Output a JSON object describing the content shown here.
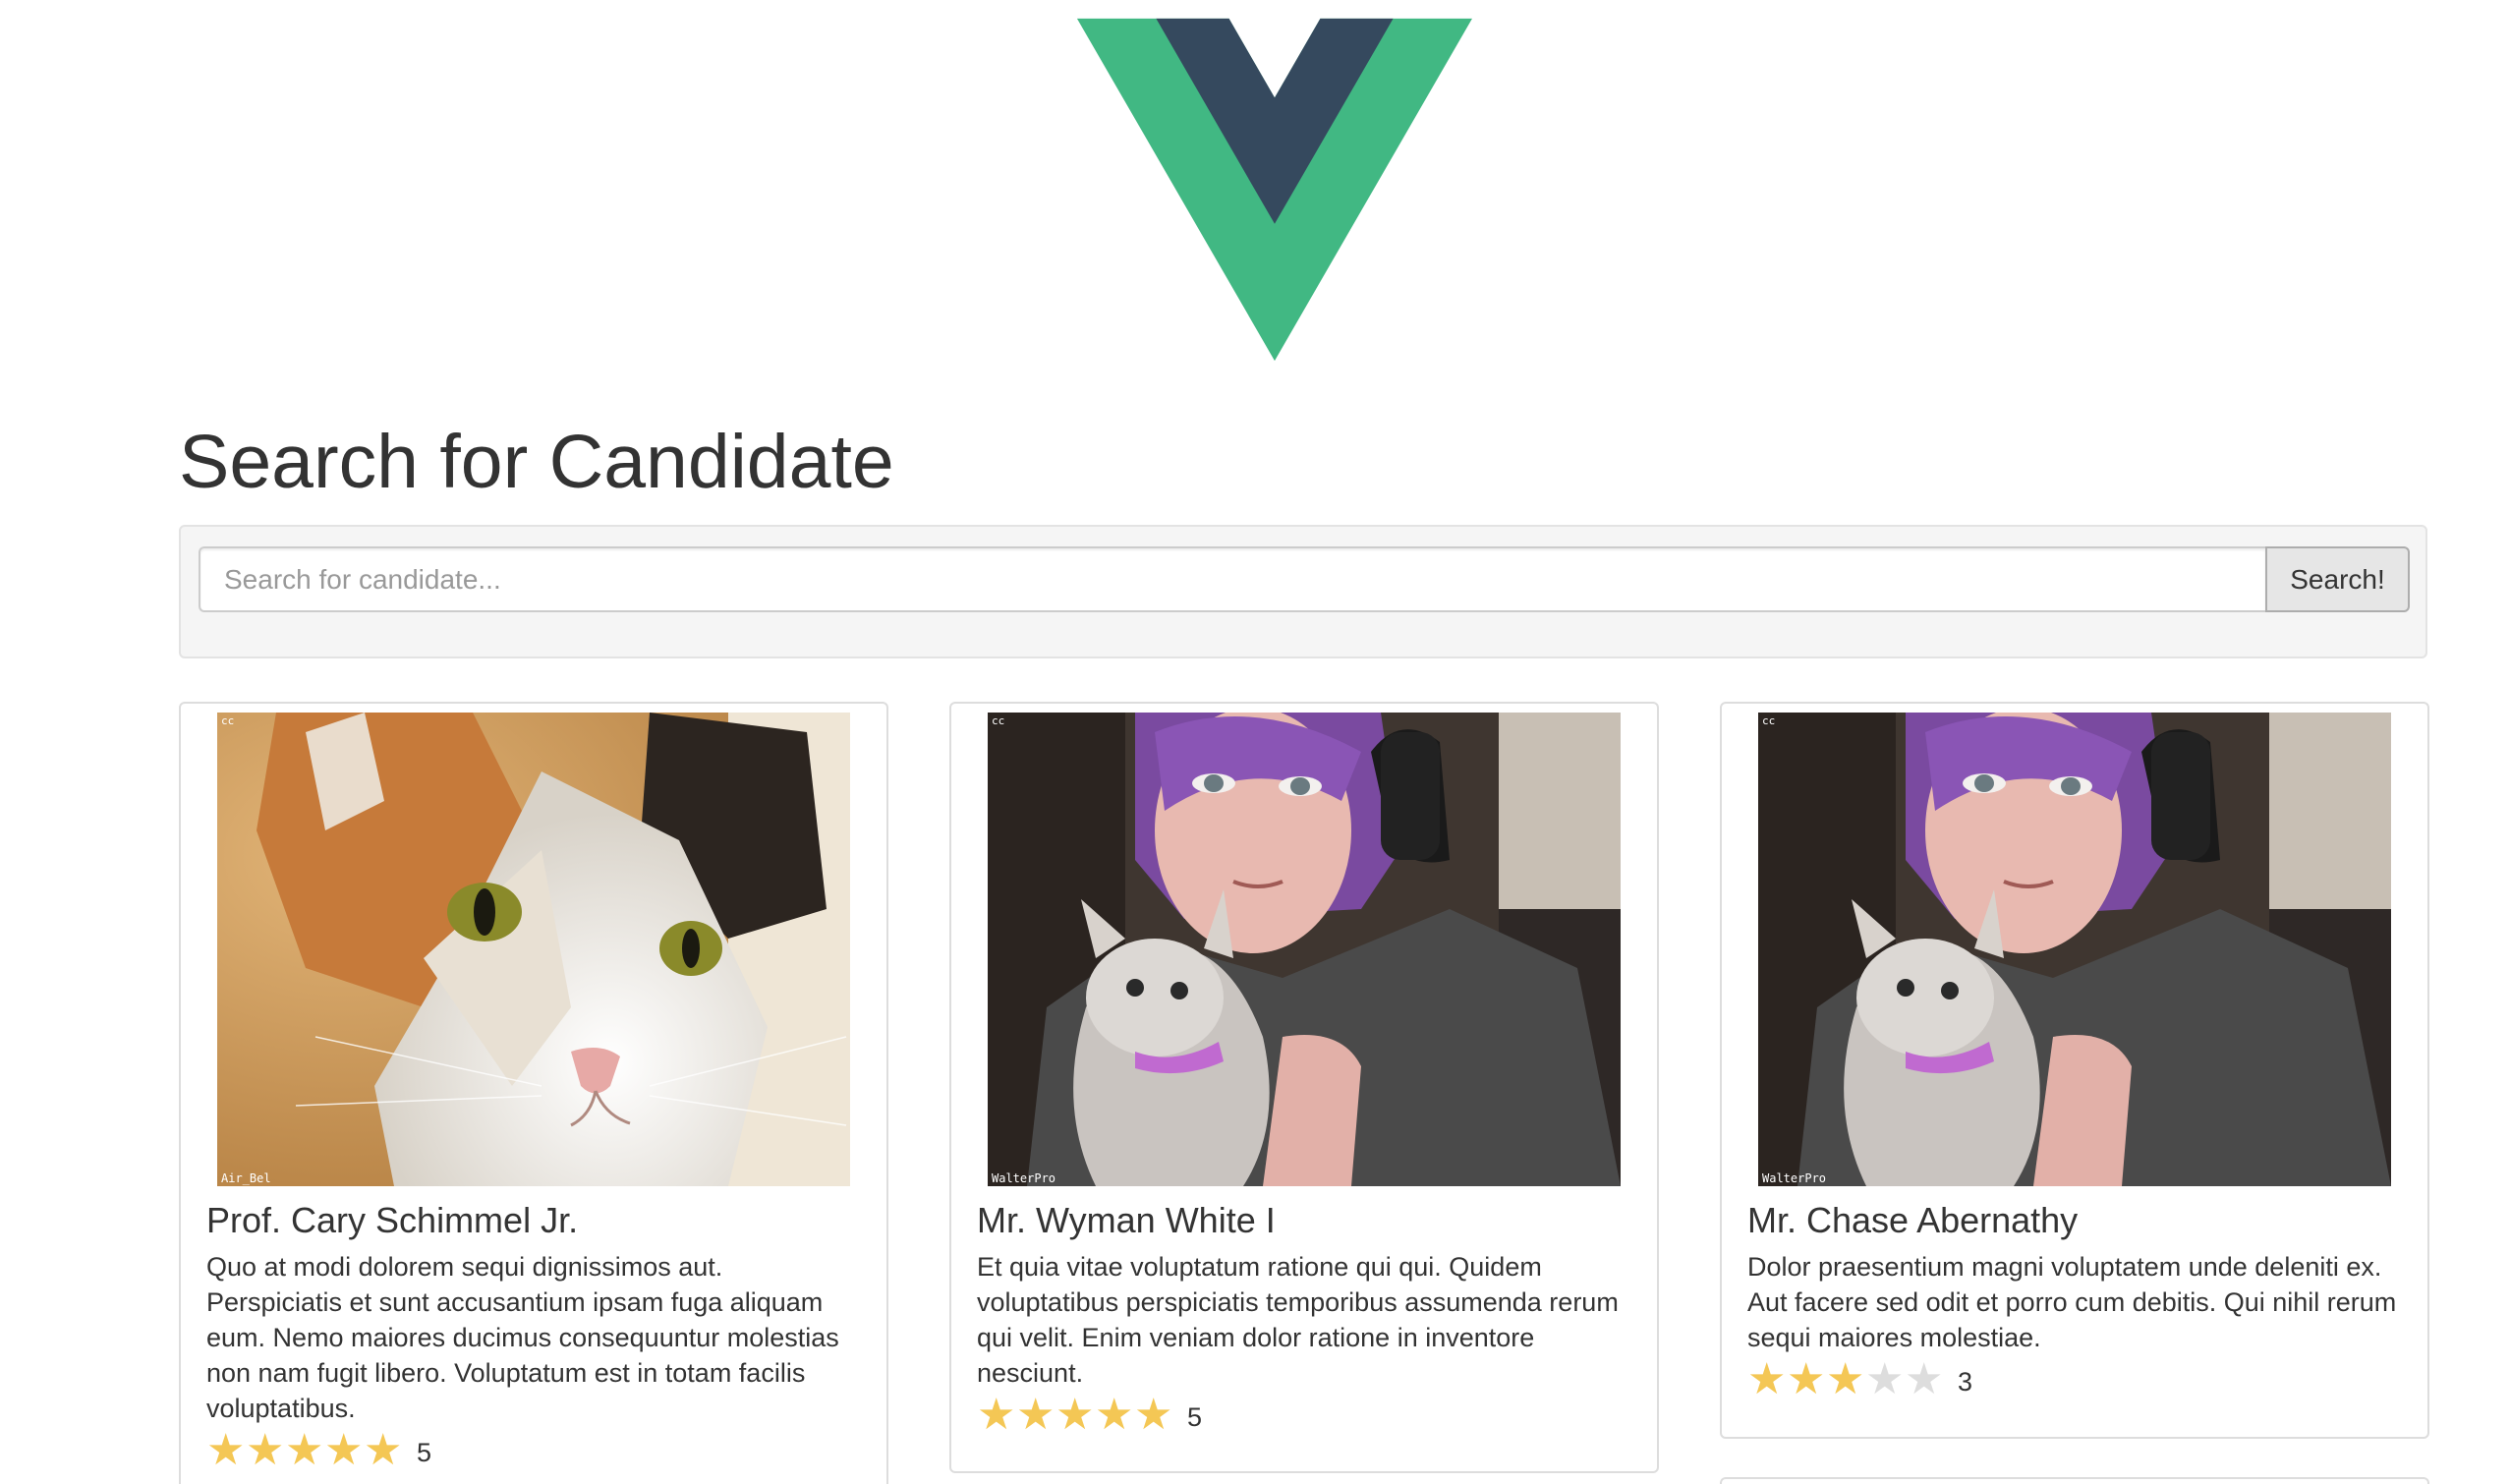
{
  "logo": {
    "name": "vue-logo",
    "colors": {
      "outer": "#41b883",
      "inner": "#35495e"
    }
  },
  "page": {
    "title": "Search for Candidate"
  },
  "search": {
    "placeholder": "Search for candidate...",
    "value": "",
    "button_label": "Search!"
  },
  "candidates": [
    {
      "name": "Prof. Cary Schimmel Jr.",
      "description": "Quo at modi dolorem sequi dignissimos aut. Perspiciatis et sunt accusantium ipsam fuga aliquam eum. Nemo maiores ducimus consequuntur molestias non nam fugit libero. Voluptatum est in totam facilis voluptatibus.",
      "rating": 5,
      "rating_label": "5",
      "photo": {
        "subject": "calico-cat-photo",
        "watermark_top": "cc",
        "watermark_bottom": "Air_Bel"
      }
    },
    {
      "name": "Mr. Wyman White I",
      "description": "Et quia vitae voluptatum ratione qui qui. Quidem voluptatibus perspiciatis temporibus assumenda rerum qui velit. Enim veniam dolor ratione in inventore nesciunt.",
      "rating": 5,
      "rating_label": "5",
      "photo": {
        "subject": "person-with-kitten-photo",
        "watermark_top": "cc",
        "watermark_bottom": "WalterPro"
      }
    },
    {
      "name": "Mr. Chase Abernathy",
      "description": "Dolor praesentium magni voluptatem unde deleniti ex. Aut facere sed odit et porro cum debitis. Qui nihil rerum sequi maiores molestiae.",
      "rating": 3,
      "rating_label": "3",
      "photo": {
        "subject": "person-with-kitten-photo",
        "watermark_top": "cc",
        "watermark_bottom": "WalterPro"
      }
    }
  ],
  "colors": {
    "star_on": "#f4c755",
    "star_off": "#dddddd"
  }
}
